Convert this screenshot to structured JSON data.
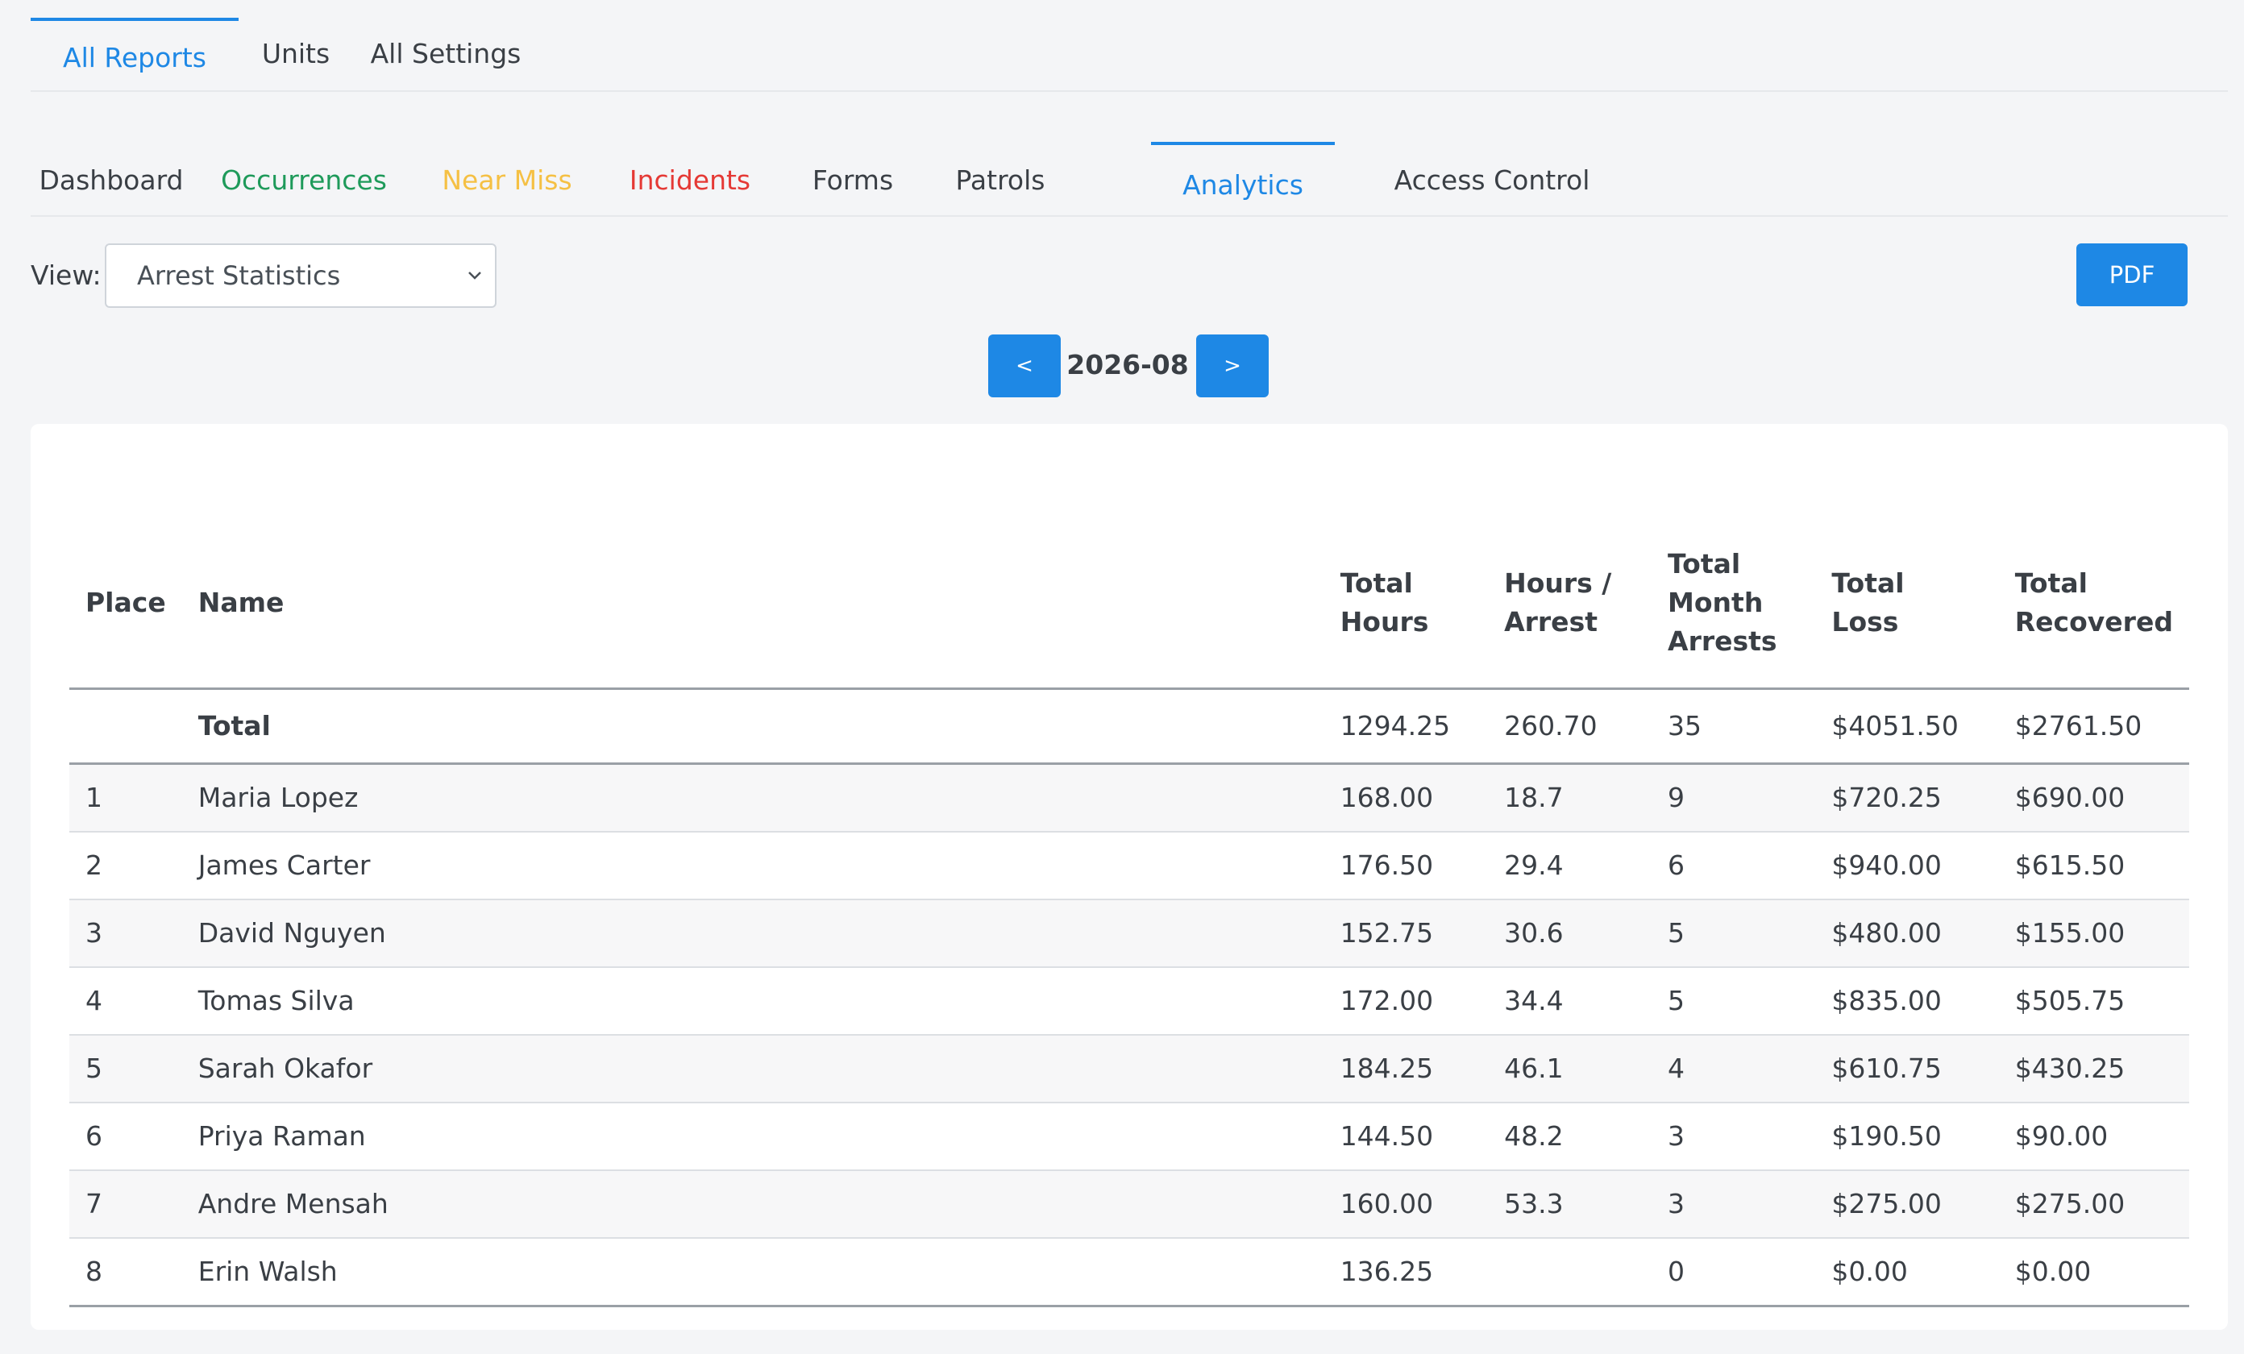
{
  "top_tabs": [
    {
      "label": "All Reports",
      "active": true
    },
    {
      "label": "Units",
      "active": false
    },
    {
      "label": "All Settings",
      "active": false
    }
  ],
  "sub_tabs": [
    {
      "label": "Dashboard",
      "color": "#3a3f45"
    },
    {
      "label": "Occurrences",
      "color": "#1e9a5a"
    },
    {
      "label": "Near Miss",
      "color": "#f5c044"
    },
    {
      "label": "Incidents",
      "color": "#e53935"
    },
    {
      "label": "Forms",
      "color": "#3a3f45"
    },
    {
      "label": "Patrols",
      "color": "#3a3f45"
    },
    {
      "label": "Analytics",
      "color": "#1e88e5"
    },
    {
      "label": "Access Control",
      "color": "#3a3f45"
    }
  ],
  "view": {
    "label": "View:",
    "selected": "Arrest Statistics",
    "icon": "chevron-down-icon"
  },
  "pdf_label": "PDF",
  "month_nav": {
    "prev_label": "<",
    "month": "2026-08",
    "next_label": ">"
  },
  "table": {
    "headers": {
      "place": "Place",
      "name": "Name",
      "total_hours_1": "Total",
      "total_hours_2": "Hours",
      "hours_arrest_1": "Hours /",
      "hours_arrest_2": "Arrest",
      "month_arrests_1": "Total",
      "month_arrests_2": "Month",
      "month_arrests_3": "Arrests",
      "total_loss_1": "Total",
      "total_loss_2": "Loss",
      "total_recovered_1": "Total",
      "total_recovered_2": "Recovered"
    },
    "total": {
      "label": "Total",
      "hours": "1294.25",
      "hours_per_arrest": "260.70",
      "arrests": "35",
      "loss": "$4051.50",
      "recovered": "$2761.50"
    },
    "rows": [
      {
        "place": "1",
        "name": "Maria Lopez",
        "hours": "168.00",
        "hours_per_arrest": "18.7",
        "arrests": "9",
        "loss": "$720.25",
        "recovered": "$690.00"
      },
      {
        "place": "2",
        "name": "James Carter",
        "hours": "176.50",
        "hours_per_arrest": "29.4",
        "arrests": "6",
        "loss": "$940.00",
        "recovered": "$615.50"
      },
      {
        "place": "3",
        "name": "David Nguyen",
        "hours": "152.75",
        "hours_per_arrest": "30.6",
        "arrests": "5",
        "loss": "$480.00",
        "recovered": "$155.00"
      },
      {
        "place": "4",
        "name": "Tomas Silva",
        "hours": "172.00",
        "hours_per_arrest": "34.4",
        "arrests": "5",
        "loss": "$835.00",
        "recovered": "$505.75"
      },
      {
        "place": "5",
        "name": "Sarah Okafor",
        "hours": "184.25",
        "hours_per_arrest": "46.1",
        "arrests": "4",
        "loss": "$610.75",
        "recovered": "$430.25"
      },
      {
        "place": "6",
        "name": "Priya Raman",
        "hours": "144.50",
        "hours_per_arrest": "48.2",
        "arrests": "3",
        "loss": "$190.50",
        "recovered": "$90.00"
      },
      {
        "place": "7",
        "name": "Andre Mensah",
        "hours": "160.00",
        "hours_per_arrest": "53.3",
        "arrests": "3",
        "loss": "$275.00",
        "recovered": "$275.00"
      },
      {
        "place": "8",
        "name": "Erin Walsh",
        "hours": "136.25",
        "hours_per_arrest": "",
        "arrests": "0",
        "loss": "$0.00",
        "recovered": "$0.00"
      }
    ]
  }
}
